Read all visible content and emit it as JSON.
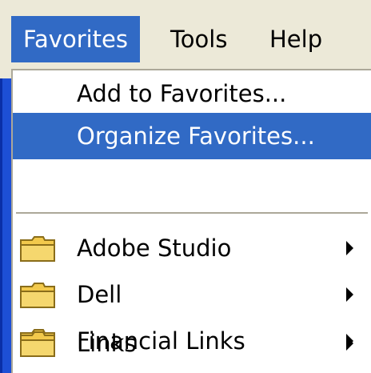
{
  "menubar": {
    "items": [
      {
        "label": "Favorites",
        "active": true
      },
      {
        "label": "Tools",
        "active": false
      },
      {
        "label": "Help",
        "active": false
      }
    ]
  },
  "favorites_menu": {
    "commands": [
      {
        "label": "Add to Favorites..."
      },
      {
        "label": "Organize Favorites...",
        "highlighted": true
      }
    ],
    "folders": [
      {
        "label": "Adobe Studio",
        "icon": "folder-icon",
        "has_submenu": true
      },
      {
        "label": "Dell",
        "icon": "folder-icon",
        "has_submenu": true
      },
      {
        "label": "Financial Links",
        "icon": "folder-icon",
        "has_submenu": true
      },
      {
        "label": "Links",
        "icon": "folder-icon",
        "has_submenu": true
      }
    ]
  },
  "colors": {
    "highlight": "#316ac5",
    "menubar_bg": "#ece9d8",
    "menu_bg": "#ffffff",
    "folder_yellow": "#f5d76e"
  }
}
